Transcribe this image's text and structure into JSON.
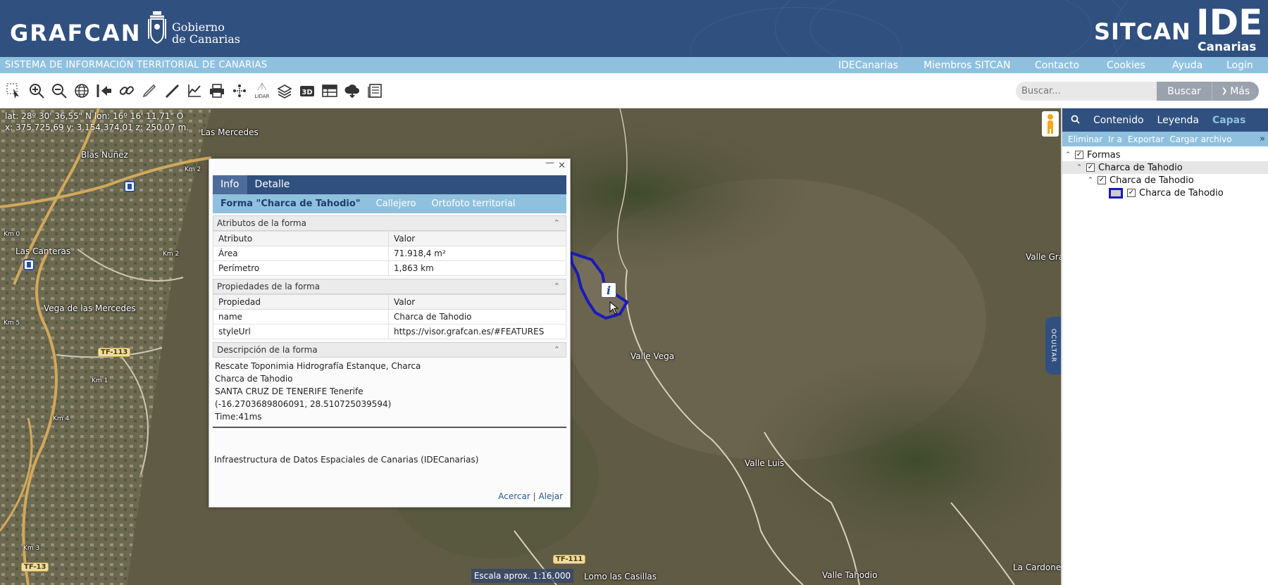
{
  "header": {
    "brand_grafcan": "GRAFCAN",
    "gobierno_line1": "Gobierno",
    "gobierno_line2": "de Canarias",
    "brand_sitcan": "SITCAN",
    "brand_ide": "IDE",
    "brand_canarias": "Canarias"
  },
  "topbar": {
    "system_name": "SISTEMA DE INFORMACIÓN TERRITORIAL DE CANARIAS",
    "links": [
      "IDECanarias",
      "Miembros SITCAN",
      "Contacto",
      "Cookies",
      "Ayuda",
      "Login"
    ]
  },
  "toolbar": {
    "icons": [
      "select-icon",
      "zoom-in-icon",
      "zoom-out-icon",
      "globe-icon",
      "home-extent-icon",
      "link-icon",
      "pencil-icon",
      "ruler-icon",
      "profile-chart-icon",
      "print-icon",
      "network-icon",
      "lidar-icon",
      "layers-icon",
      "3d-icon",
      "table-icon",
      "cloud-download-icon",
      "report-icon"
    ],
    "lidar_label": "LIDAR",
    "search_placeholder": "Buscar...",
    "search_button": "Buscar",
    "more_button": "Más"
  },
  "map": {
    "coords_line1": "lat: 28º 30' 36,55\" N  lon: 16º 16' 11,71\" O",
    "coords_line2": "x: 375.725,69  y: 3.154.374,01  z: 250,07 m.",
    "place_names": [
      "Las Mercedes",
      "Blas Nuñez",
      "Las Canteras",
      "Vega de las Mercedes",
      "Km 2",
      "Km 1",
      "Km 4",
      "Km 5",
      "Km 0",
      "Km 3",
      "Km 2",
      "Valle Vega",
      "Valle Luis",
      "Valle Gran",
      "Lomo las Casillas",
      "Valle Tahodio",
      "La Cardonera"
    ],
    "road_labels": [
      "TF-113",
      "TF-13",
      "TF-111"
    ],
    "scale_text": "Escala aprox. 1:16.000",
    "hide_panel": "OCULTAR"
  },
  "popup": {
    "tabs": [
      "Info",
      "Detalle"
    ],
    "active_tab": "Info",
    "subtabs": [
      "Forma \"Charca de Tahodio\"",
      "Callejero",
      "Ortofoto territorial"
    ],
    "attributes": {
      "title": "Atributos de la forma",
      "headers": [
        "Atributo",
        "Valor"
      ],
      "rows": [
        [
          "Área",
          "71.918,4 m²"
        ],
        [
          "Perímetro",
          "1,863 km"
        ]
      ]
    },
    "properties": {
      "title": "Propiedades de la forma",
      "headers": [
        "Propiedad",
        "Valor"
      ],
      "rows": [
        [
          "name",
          "Charca de Tahodio"
        ],
        [
          "styleUrl",
          "https://visor.grafcan.es/#FEATURES"
        ]
      ]
    },
    "description": {
      "title": "Descripción de la forma",
      "lines": [
        "Rescate Toponimia Hidrografía Estanque, Charca",
        "Charca de Tahodio",
        "SANTA CRUZ DE TENERIFE Tenerife",
        "(-16.2703689806091, 28.510725039594)",
        "Time:41ms"
      ]
    },
    "attribution": "Infraestructura de Datos Espaciales de Canarias (IDECanarias)",
    "zoom_in": "Acercar",
    "zoom_out": "Alejar"
  },
  "right_panel": {
    "tabs": [
      "Contenido",
      "Leyenda",
      "Capas"
    ],
    "active_tab": "Capas",
    "actions": [
      "Eliminar",
      "Ir a",
      "Exportar",
      "Cargar archivo"
    ],
    "tree": [
      {
        "label": "Formas",
        "level": 0
      },
      {
        "label": "Charca de Tahodio",
        "level": 1
      },
      {
        "label": "Charca de Tahodio",
        "level": 2
      },
      {
        "label": "Charca de Tahodio",
        "level": 3
      }
    ]
  },
  "colors": {
    "header_blue": "#30507f",
    "light_blue": "#8fc1df",
    "polygon": "#1a1ab8"
  }
}
